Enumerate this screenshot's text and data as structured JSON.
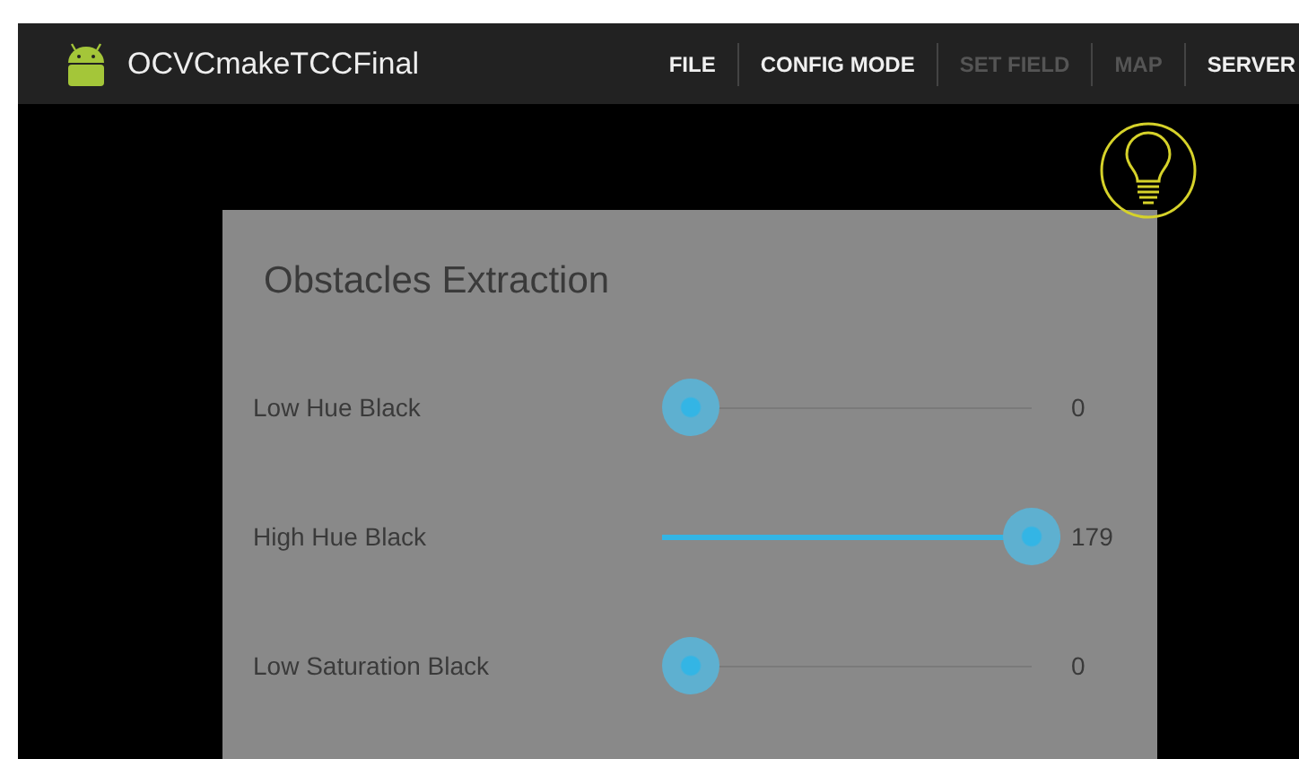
{
  "action_bar": {
    "title": "OCVCmakeTCCFinal",
    "menu": [
      {
        "label": "FILE",
        "disabled": false
      },
      {
        "label": "CONFIG MODE",
        "disabled": false
      },
      {
        "label": "SET FIELD",
        "disabled": true
      },
      {
        "label": "MAP",
        "disabled": true
      },
      {
        "label": "SERVER",
        "disabled": false
      }
    ]
  },
  "dialog": {
    "title": "Obstacles Extraction",
    "sliders": [
      {
        "label": "Low Hue Black",
        "level": 0,
        "reading": "0"
      },
      {
        "label": "High Hue Black",
        "level": 1,
        "reading": "179"
      },
      {
        "label": "Low Saturation Black",
        "level": 0,
        "reading": "0"
      }
    ]
  }
}
